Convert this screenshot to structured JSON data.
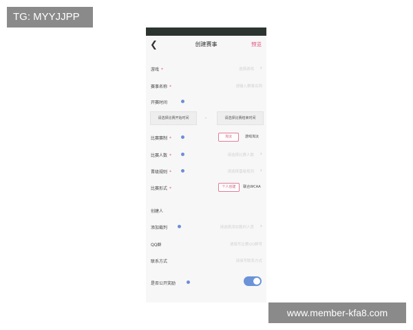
{
  "watermarks": {
    "tg": "TG: MYYJJPP",
    "site": "www.member-kfa8.com"
  },
  "header": {
    "back_icon": "chevron-left-icon",
    "title": "创建赛事",
    "preview": "预览"
  },
  "form": {
    "game": {
      "label": "游戏",
      "placeholder": "选择游戏"
    },
    "name": {
      "label": "赛事名称",
      "placeholder": "请输入赛事名称"
    },
    "time": {
      "label": "开赛时间",
      "start": "请选择比赛开始时间",
      "dash": "-",
      "end": "请选择比赛结束时间"
    },
    "system": {
      "label": "比赛赛制",
      "option1": "淘汰",
      "option2": "游戏淘汰"
    },
    "count": {
      "label": "比赛人数",
      "placeholder": "请选择比赛人数"
    },
    "promo": {
      "label": "晋级规则",
      "placeholder": "请选择晋级规则"
    },
    "format": {
      "label": "比赛形式",
      "option1": "个人创建",
      "option2": "联合WCAA"
    },
    "creator": {
      "label": "创建人"
    },
    "referee": {
      "label": "添加裁判",
      "placeholder": "请选择添加裁判人员"
    },
    "qq": {
      "label": "QQ群",
      "placeholder": "请填写比赛QQ群号"
    },
    "contact": {
      "label": "联系方式",
      "placeholder": "请填写联系方式"
    },
    "reward": {
      "label": "是否公开奖励",
      "enabled": true
    }
  },
  "colors": {
    "accent": "#e0507a",
    "toggle": "#6a93d8",
    "info": "#6c8ed8"
  }
}
